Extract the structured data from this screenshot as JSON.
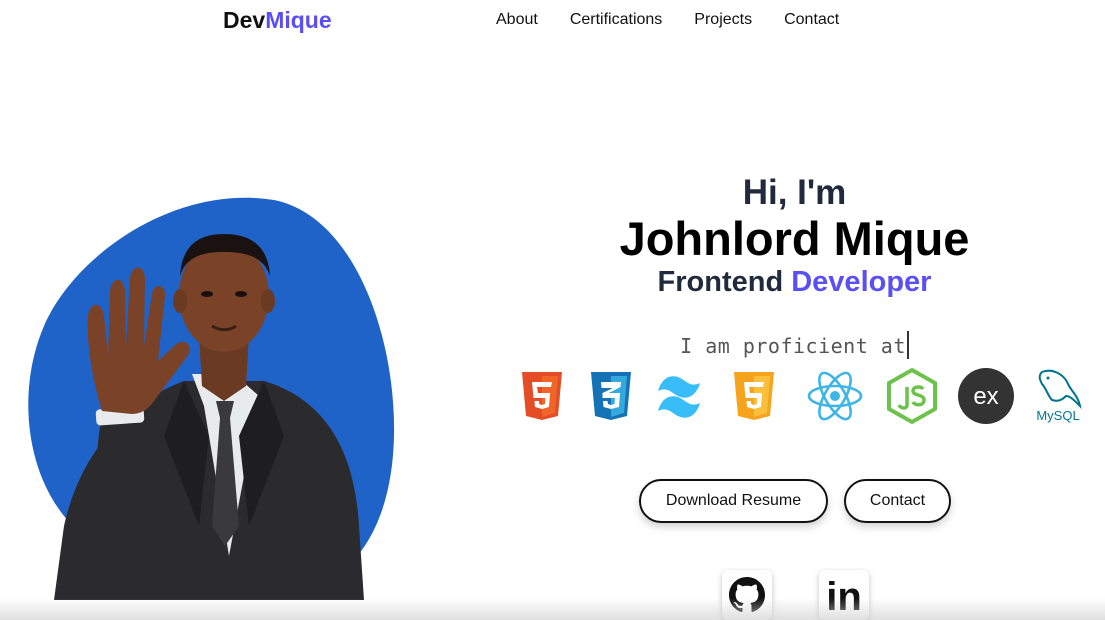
{
  "header": {
    "logo_main": "Dev",
    "logo_accent": "Mique",
    "nav": [
      "About",
      "Certifications",
      "Projects",
      "Contact"
    ]
  },
  "hero": {
    "greeting": "Hi, I'm",
    "name": "Johnlord Mique",
    "role_main": "Frontend",
    "role_accent": "Developer",
    "typed_text": "I am proficient at"
  },
  "skills": [
    {
      "icon": "html5-icon",
      "color": "#e44d26"
    },
    {
      "icon": "css3-icon",
      "color": "#1572b6"
    },
    {
      "icon": "tailwind-icon",
      "color": "#38bdf8"
    },
    {
      "icon": "javascript-icon",
      "color": "#f7a41d"
    },
    {
      "icon": "react-icon",
      "color": "#61dafb"
    },
    {
      "icon": "nodejs-icon",
      "color": "#6cc24a"
    },
    {
      "icon": "express-icon",
      "color": "#333333"
    },
    {
      "icon": "mysql-icon",
      "color": "#00758f",
      "label": "MySQL"
    }
  ],
  "buttons": {
    "resume": "Download Resume",
    "contact": "Contact"
  },
  "socials": [
    {
      "icon": "github-icon"
    },
    {
      "icon": "linkedin-icon",
      "label": "in"
    }
  ],
  "colors": {
    "accent": "#5a4ff5",
    "blob": "#1f63c8",
    "heading": "#1f2a3c"
  }
}
